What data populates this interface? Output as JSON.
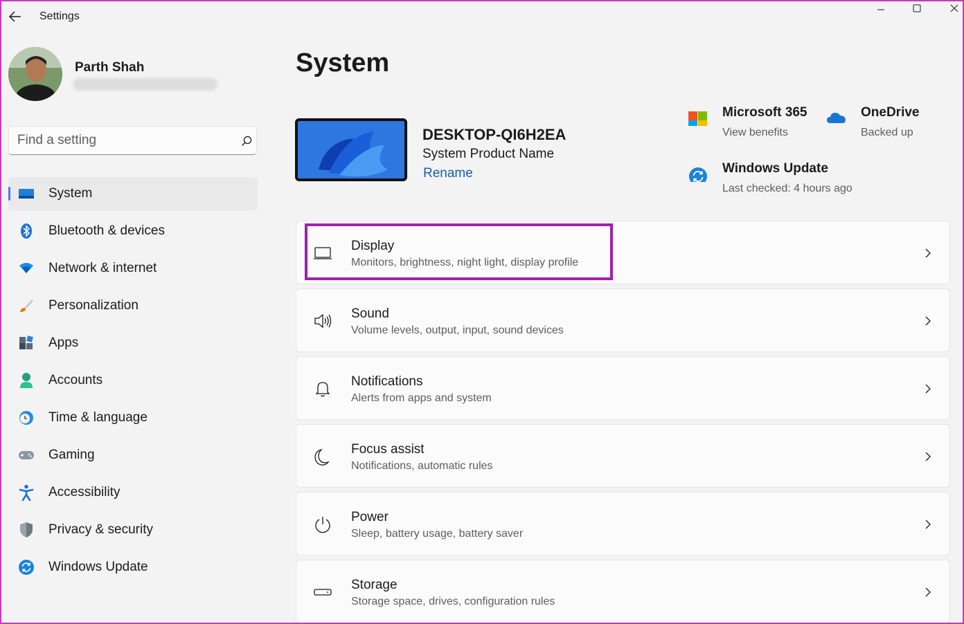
{
  "window": {
    "title": "Settings",
    "controls": [
      "minimize",
      "maximize",
      "close"
    ]
  },
  "profile": {
    "name": "Parth Shah"
  },
  "search": {
    "placeholder": "Find a setting"
  },
  "sidebar": {
    "items": [
      {
        "label": "System",
        "icon": "system-icon",
        "selected": true
      },
      {
        "label": "Bluetooth & devices",
        "icon": "bluetooth-icon"
      },
      {
        "label": "Network & internet",
        "icon": "wifi-icon"
      },
      {
        "label": "Personalization",
        "icon": "brush-icon"
      },
      {
        "label": "Apps",
        "icon": "apps-icon"
      },
      {
        "label": "Accounts",
        "icon": "account-icon"
      },
      {
        "label": "Time & language",
        "icon": "clock-globe-icon"
      },
      {
        "label": "Gaming",
        "icon": "gamepad-icon"
      },
      {
        "label": "Accessibility",
        "icon": "accessibility-icon"
      },
      {
        "label": "Privacy & security",
        "icon": "shield-icon"
      },
      {
        "label": "Windows Update",
        "icon": "update-icon"
      }
    ]
  },
  "main": {
    "title": "System",
    "device": {
      "name": "DESKTOP-QI6H2EA",
      "model": "System Product Name",
      "rename_label": "Rename"
    },
    "quick_actions": [
      {
        "title": "Microsoft 365",
        "subtitle": "View benefits",
        "icon": "microsoft-logo-icon"
      },
      {
        "title": "OneDrive",
        "subtitle": "Backed up",
        "icon": "onedrive-cloud-icon"
      },
      {
        "title": "Windows Update",
        "subtitle": "Last checked: 4 hours ago",
        "icon": "windows-update-icon"
      }
    ],
    "settings": [
      {
        "title": "Display",
        "subtitle": "Monitors, brightness, night light, display profile",
        "icon": "display-icon",
        "highlighted": true
      },
      {
        "title": "Sound",
        "subtitle": "Volume levels, output, input, sound devices",
        "icon": "speaker-icon"
      },
      {
        "title": "Notifications",
        "subtitle": "Alerts from apps and system",
        "icon": "bell-icon"
      },
      {
        "title": "Focus assist",
        "subtitle": "Notifications, automatic rules",
        "icon": "moon-icon"
      },
      {
        "title": "Power",
        "subtitle": "Sleep, battery usage, battery saver",
        "icon": "power-icon"
      },
      {
        "title": "Storage",
        "subtitle": "Storage space, drives, configuration rules",
        "icon": "storage-drive-icon"
      }
    ]
  },
  "colors": {
    "accent": "#4d6fff",
    "highlight_box": "#a020b0",
    "link": "#1a5fb4",
    "frame": "#c43bb7"
  }
}
